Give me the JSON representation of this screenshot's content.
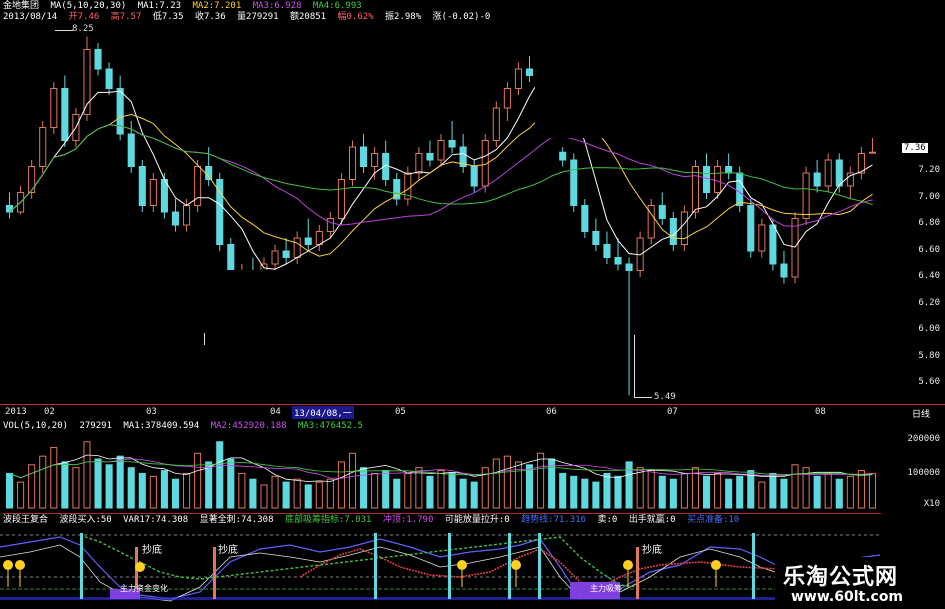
{
  "header": {
    "stock_name": "金地集团",
    "ma_label": "MA(5,10,20,30)",
    "ma1": "MA1:7.23",
    "ma2": "MA2:7.201",
    "ma3": "MA3:6.928",
    "ma4": "MA4:6.993",
    "date": "2013/08/14",
    "open": "开7.46",
    "high": "高7.57",
    "low": "低7.35",
    "close": "收7.36",
    "volume": "量279291",
    "amount": "额20851",
    "change_pct": "幅0.62%",
    "amplitude": "振2.98%",
    "rise": "涨(-0.02)-0"
  },
  "price_axis": {
    "ticks": [
      "7.20",
      "7.00",
      "6.80",
      "6.60",
      "6.40",
      "6.20",
      "6.00",
      "5.80",
      "5.60"
    ],
    "current_price_tag": "7.36",
    "high_mark": "8.25",
    "low_mark": "5.49"
  },
  "date_axis": {
    "labels": [
      "2013",
      "02",
      "03",
      "04",
      "05",
      "06",
      "07",
      "08"
    ],
    "cursor_date": "13/04/08,一",
    "period_button": "日线"
  },
  "volume_panel": {
    "label": "VOL(5,10,20)",
    "value": "279291",
    "ma1": "MA1:378409.594",
    "ma2": "MA2:452920.188",
    "ma3": "MA3:476452.5",
    "ticks": [
      "200000",
      "100000"
    ],
    "unit": "X10"
  },
  "indicator_panel": {
    "name": "波段王复合",
    "buy": "波段买入:50",
    "var17": "VAR17:74.308",
    "comprehensive": "显著全刺:74.308",
    "bottom_index": "底部吸筹指标:7.031",
    "rush": "冲顶:1.790",
    "pull": "可能放量拉升:0",
    "trend": "趋势线:71.316",
    "sell": "卖:0",
    "exit": "出手就赢:0",
    "buy_ready": "买点准备:10",
    "marker_labels": [
      "抄底",
      "抄底",
      "抄底"
    ],
    "bottom_text_1": "主力资金变化",
    "bottom_text_2": "主力吸筹"
  },
  "watermark": {
    "name": "乐淘公式网",
    "url": "www.60lt.com"
  },
  "colors": {
    "up": "#e0785a",
    "down": "#5fd9e0",
    "ma5": "#ffffff",
    "ma10": "#ffd040",
    "ma20": "#c040e0",
    "ma30": "#40c040"
  },
  "chart_data": {
    "type": "candlestick",
    "ylim": [
      5.5,
      8.3
    ],
    "candles": [
      {
        "o": 6.95,
        "h": 7.05,
        "l": 6.85,
        "c": 6.9
      },
      {
        "o": 6.9,
        "h": 7.1,
        "l": 6.88,
        "c": 7.05
      },
      {
        "o": 7.05,
        "h": 7.3,
        "l": 7.0,
        "c": 7.25
      },
      {
        "o": 7.25,
        "h": 7.6,
        "l": 7.2,
        "c": 7.55
      },
      {
        "o": 7.55,
        "h": 7.9,
        "l": 7.5,
        "c": 7.85
      },
      {
        "o": 7.85,
        "h": 7.95,
        "l": 7.4,
        "c": 7.45
      },
      {
        "o": 7.45,
        "h": 7.7,
        "l": 7.4,
        "c": 7.65
      },
      {
        "o": 7.65,
        "h": 8.25,
        "l": 7.6,
        "c": 8.15
      },
      {
        "o": 8.15,
        "h": 8.2,
        "l": 7.95,
        "c": 8.0
      },
      {
        "o": 8.0,
        "h": 8.05,
        "l": 7.8,
        "c": 7.85
      },
      {
        "o": 7.85,
        "h": 7.95,
        "l": 7.45,
        "c": 7.5
      },
      {
        "o": 7.5,
        "h": 7.6,
        "l": 7.2,
        "c": 7.25
      },
      {
        "o": 7.25,
        "h": 7.3,
        "l": 6.9,
        "c": 6.95
      },
      {
        "o": 6.95,
        "h": 7.2,
        "l": 6.9,
        "c": 7.15
      },
      {
        "o": 7.15,
        "h": 7.2,
        "l": 6.85,
        "c": 6.9
      },
      {
        "o": 6.9,
        "h": 7.0,
        "l": 6.75,
        "c": 6.8
      },
      {
        "o": 6.8,
        "h": 7.0,
        "l": 6.75,
        "c": 6.95
      },
      {
        "o": 6.95,
        "h": 7.3,
        "l": 6.9,
        "c": 7.25
      },
      {
        "o": 7.25,
        "h": 7.4,
        "l": 7.1,
        "c": 7.15
      },
      {
        "o": 7.15,
        "h": 7.2,
        "l": 6.6,
        "c": 6.65
      },
      {
        "o": 6.65,
        "h": 6.7,
        "l": 6.3,
        "c": 6.35
      },
      {
        "o": 6.35,
        "h": 6.5,
        "l": 6.3,
        "c": 6.45
      },
      {
        "o": 6.45,
        "h": 6.55,
        "l": 6.35,
        "c": 6.4
      },
      {
        "o": 6.4,
        "h": 6.55,
        "l": 6.35,
        "c": 6.5
      },
      {
        "o": 6.5,
        "h": 6.65,
        "l": 6.45,
        "c": 6.6
      },
      {
        "o": 6.6,
        "h": 6.7,
        "l": 6.5,
        "c": 6.55
      },
      {
        "o": 6.55,
        "h": 6.75,
        "l": 6.5,
        "c": 6.7
      },
      {
        "o": 6.7,
        "h": 6.85,
        "l": 6.6,
        "c": 6.65
      },
      {
        "o": 6.65,
        "h": 6.8,
        "l": 6.6,
        "c": 6.75
      },
      {
        "o": 6.75,
        "h": 6.9,
        "l": 6.7,
        "c": 6.85
      },
      {
        "o": 6.85,
        "h": 7.2,
        "l": 6.8,
        "c": 7.15
      },
      {
        "o": 7.15,
        "h": 7.45,
        "l": 7.1,
        "c": 7.4
      },
      {
        "o": 7.4,
        "h": 7.5,
        "l": 7.2,
        "c": 7.25
      },
      {
        "o": 7.25,
        "h": 7.4,
        "l": 7.15,
        "c": 7.35
      },
      {
        "o": 7.35,
        "h": 7.45,
        "l": 7.1,
        "c": 7.15
      },
      {
        "o": 7.15,
        "h": 7.2,
        "l": 6.95,
        "c": 7.0
      },
      {
        "o": 7.0,
        "h": 7.25,
        "l": 6.95,
        "c": 7.2
      },
      {
        "o": 7.2,
        "h": 7.4,
        "l": 7.15,
        "c": 7.35
      },
      {
        "o": 7.35,
        "h": 7.45,
        "l": 7.25,
        "c": 7.3
      },
      {
        "o": 7.3,
        "h": 7.5,
        "l": 7.25,
        "c": 7.45
      },
      {
        "o": 7.45,
        "h": 7.6,
        "l": 7.35,
        "c": 7.4
      },
      {
        "o": 7.4,
        "h": 7.5,
        "l": 7.2,
        "c": 7.25
      },
      {
        "o": 7.25,
        "h": 7.3,
        "l": 7.05,
        "c": 7.1
      },
      {
        "o": 7.1,
        "h": 7.5,
        "l": 7.05,
        "c": 7.45
      },
      {
        "o": 7.45,
        "h": 7.75,
        "l": 7.4,
        "c": 7.7
      },
      {
        "o": 7.7,
        "h": 7.9,
        "l": 7.6,
        "c": 7.85
      },
      {
        "o": 7.85,
        "h": 8.05,
        "l": 7.8,
        "c": 8.0
      },
      {
        "o": 8.0,
        "h": 8.1,
        "l": 7.9,
        "c": 7.95
      },
      {
        "o": 7.95,
        "h": 8.25,
        "l": 7.9,
        "c": 8.15
      },
      {
        "o": 8.15,
        "h": 8.2,
        "l": 8.0,
        "c": 8.05
      },
      {
        "o": 7.36,
        "h": 7.4,
        "l": 7.25,
        "c": 7.3
      },
      {
        "o": 7.3,
        "h": 7.35,
        "l": 6.9,
        "c": 6.95
      },
      {
        "o": 6.95,
        "h": 7.0,
        "l": 6.7,
        "c": 6.75
      },
      {
        "o": 6.75,
        "h": 6.85,
        "l": 6.6,
        "c": 6.65
      },
      {
        "o": 6.65,
        "h": 6.75,
        "l": 6.5,
        "c": 6.55
      },
      {
        "o": 6.55,
        "h": 6.7,
        "l": 6.45,
        "c": 6.5
      },
      {
        "o": 6.5,
        "h": 6.55,
        "l": 5.49,
        "c": 6.45
      },
      {
        "o": 6.45,
        "h": 6.75,
        "l": 6.4,
        "c": 6.7
      },
      {
        "o": 6.7,
        "h": 7.0,
        "l": 6.65,
        "c": 6.95
      },
      {
        "o": 6.95,
        "h": 7.05,
        "l": 6.8,
        "c": 6.85
      },
      {
        "o": 6.85,
        "h": 6.9,
        "l": 6.6,
        "c": 6.65
      },
      {
        "o": 6.65,
        "h": 6.95,
        "l": 6.6,
        "c": 6.9
      },
      {
        "o": 6.9,
        "h": 7.3,
        "l": 6.85,
        "c": 7.25
      },
      {
        "o": 7.25,
        "h": 7.35,
        "l": 7.0,
        "c": 7.05
      },
      {
        "o": 7.05,
        "h": 7.3,
        "l": 7.0,
        "c": 7.25
      },
      {
        "o": 7.25,
        "h": 7.35,
        "l": 7.15,
        "c": 7.2
      },
      {
        "o": 7.2,
        "h": 7.25,
        "l": 6.9,
        "c": 6.95
      },
      {
        "o": 6.95,
        "h": 7.0,
        "l": 6.55,
        "c": 6.6
      },
      {
        "o": 6.6,
        "h": 6.85,
        "l": 6.55,
        "c": 6.8
      },
      {
        "o": 6.8,
        "h": 6.85,
        "l": 6.45,
        "c": 6.5
      },
      {
        "o": 6.5,
        "h": 6.6,
        "l": 6.35,
        "c": 6.4
      },
      {
        "o": 6.4,
        "h": 6.9,
        "l": 6.35,
        "c": 6.85
      },
      {
        "o": 6.85,
        "h": 7.25,
        "l": 6.8,
        "c": 7.2
      },
      {
        "o": 7.2,
        "h": 7.3,
        "l": 7.05,
        "c": 7.1
      },
      {
        "o": 7.1,
        "h": 7.35,
        "l": 7.05,
        "c": 7.3
      },
      {
        "o": 7.3,
        "h": 7.35,
        "l": 7.05,
        "c": 7.1
      },
      {
        "o": 7.1,
        "h": 7.25,
        "l": 7.0,
        "c": 7.2
      },
      {
        "o": 7.2,
        "h": 7.4,
        "l": 7.15,
        "c": 7.35
      },
      {
        "o": 7.36,
        "h": 7.57,
        "l": 7.35,
        "c": 7.36
      }
    ],
    "volumes": [
      120,
      90,
      150,
      180,
      210,
      160,
      140,
      230,
      170,
      150,
      180,
      140,
      120,
      110,
      130,
      100,
      120,
      190,
      160,
      230,
      170,
      120,
      100,
      80,
      110,
      90,
      100,
      80,
      90,
      100,
      160,
      190,
      140,
      120,
      130,
      100,
      120,
      140,
      110,
      130,
      120,
      100,
      90,
      140,
      170,
      180,
      160,
      150,
      190,
      170,
      120,
      110,
      100,
      90,
      120,
      110,
      160,
      140,
      130,
      110,
      100,
      120,
      140,
      110,
      120,
      100,
      110,
      130,
      90,
      120,
      100,
      150,
      140,
      110,
      120,
      100,
      110,
      130,
      120
    ],
    "vol_ylim": [
      0,
      250
    ]
  }
}
